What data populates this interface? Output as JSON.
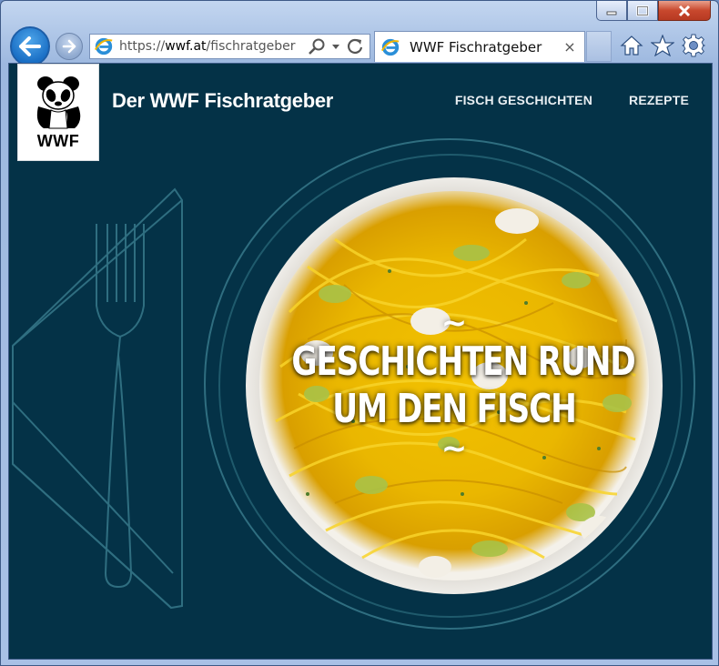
{
  "browser": {
    "address_prefix": "https://",
    "address_domain": "wwf.at",
    "address_path": "/fischratgeber",
    "tab_title": "WWF Fischratgeber",
    "tab_close": "×",
    "icons": [
      "back-icon",
      "forward-icon",
      "ie-icon",
      "search-icon",
      "refresh-icon",
      "home-icon",
      "star-icon",
      "gear-icon",
      "minimize-icon",
      "maximize-icon",
      "close-icon"
    ]
  },
  "site": {
    "logo_text": "WWF",
    "title": "Der WWF Fischratgeber",
    "menu": [
      {
        "label": "FISCH GESCHICHTEN"
      },
      {
        "label": "REZEPTE"
      }
    ]
  },
  "hero": {
    "tilde_top": "~",
    "line1": "GESCHICHTEN RUND",
    "line2": "UM DEN FISCH",
    "tilde_bottom": "~"
  },
  "colors": {
    "page_bg": "#043247",
    "line_art": "#2f6e80",
    "accent_blue": "#1a6fc5"
  }
}
